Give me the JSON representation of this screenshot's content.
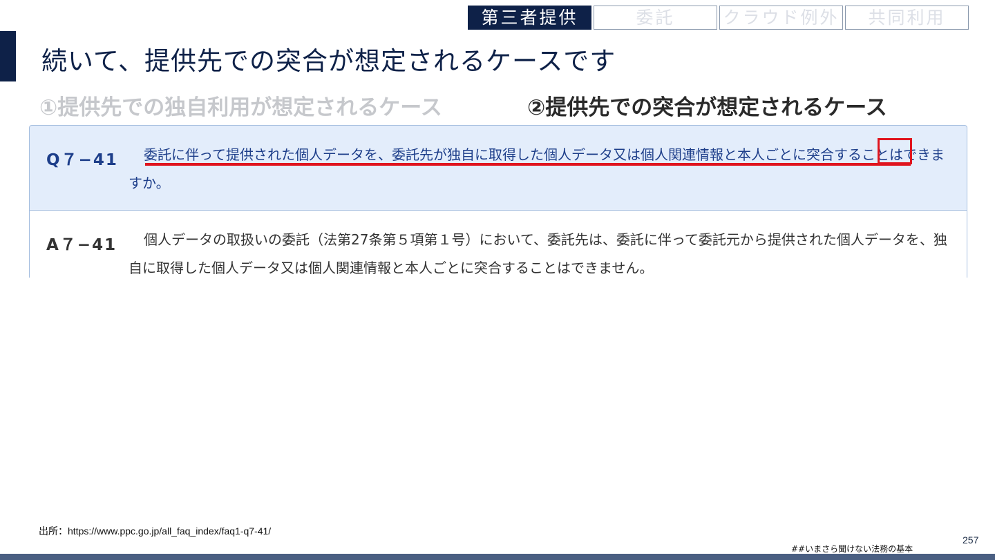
{
  "tabs": [
    {
      "label": "第三者提供",
      "active": true
    },
    {
      "label": "委託",
      "active": false
    },
    {
      "label": "クラウド例外",
      "active": false
    },
    {
      "label": "共同利用",
      "active": false
    }
  ],
  "title": "続いて、提供先での突合が想定されるケースです",
  "cases": {
    "case1": "①提供先での独自利用が想定されるケース",
    "case2": "②提供先での突合が想定されるケース"
  },
  "faq": {
    "question_label": "Q７−41",
    "question_text": "委託に伴って提供された個人データを、委託先が独自に取得した個人データ又は個人関連情報と本人ごとに突合することはできますか。",
    "answer_label": "A７−41",
    "answer_text": "個人データの取扱いの委託（法第27条第５項第１号）において、委託先は、委託に伴って委託元から提供された個人データを、独自に取得した個人データ又は個人関連情報と本人ごとに突合することはできません。"
  },
  "source": "出所：https://www.ppc.go.jp/all_faq_index/faq1-q7-41/",
  "footer_tag": "##いまさら聞けない法務の基本",
  "page_number": "257",
  "colors": {
    "navy": "#0e2148",
    "question_bg": "#e3edfb",
    "highlight_red": "#e0141e",
    "question_text": "#1d3e8a"
  }
}
